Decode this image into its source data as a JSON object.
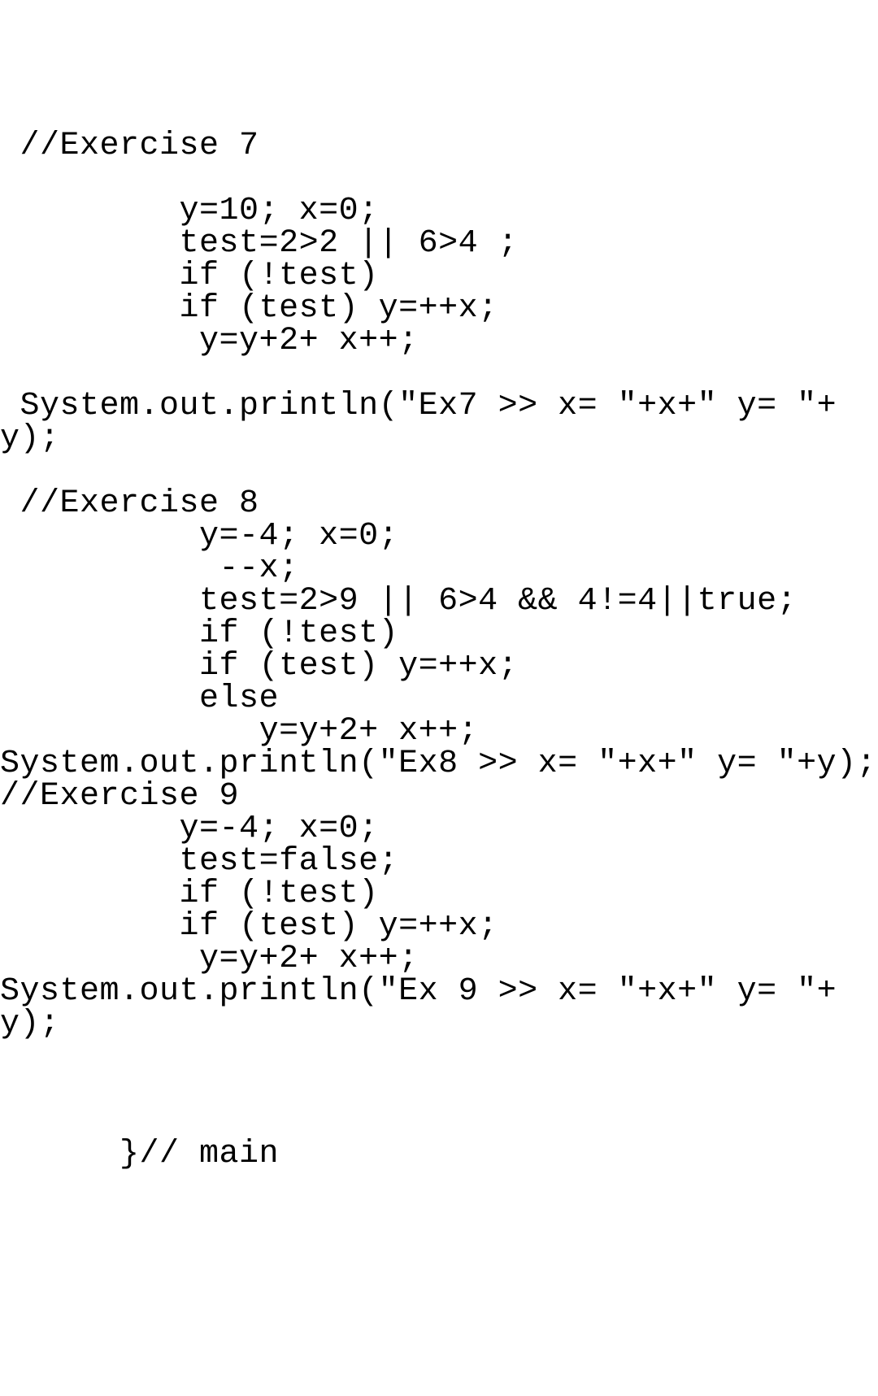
{
  "code": {
    "line1": " //Exercise 7",
    "line2": "",
    "line3": "         y=10; x=0;",
    "line4": "         test=2>2 || 6>4 ;",
    "line5": "         if (!test)",
    "line6": "         if (test) y=++x;",
    "line7": "          y=y+2+ x++;",
    "line8": "",
    "line9": " System.out.println(\"Ex7 >> x= \"+x+\" y= \"+y);",
    "line10": "",
    "line11": " //Exercise 8",
    "line12": "          y=-4; x=0;",
    "line13": "           --x;",
    "line14": "          test=2>9 || 6>4 && 4!=4||true;",
    "line15": "          if (!test)",
    "line16": "          if (test) y=++x;",
    "line17": "          else",
    "line18": "             y=y+2+ x++;",
    "line19": "System.out.println(\"Ex8 >> x= \"+x+\" y= \"+y);",
    "line20": "//Exercise 9",
    "line21": "         y=-4; x=0;",
    "line22": "         test=false;",
    "line23": "         if (!test)",
    "line24": "         if (test) y=++x;",
    "line25": "          y=y+2+ x++;",
    "line26": "System.out.println(\"Ex 9 >> x= \"+x+\" y= \"+y);",
    "line27": "",
    "line28": "",
    "line29": "",
    "line30": "      }// main"
  }
}
